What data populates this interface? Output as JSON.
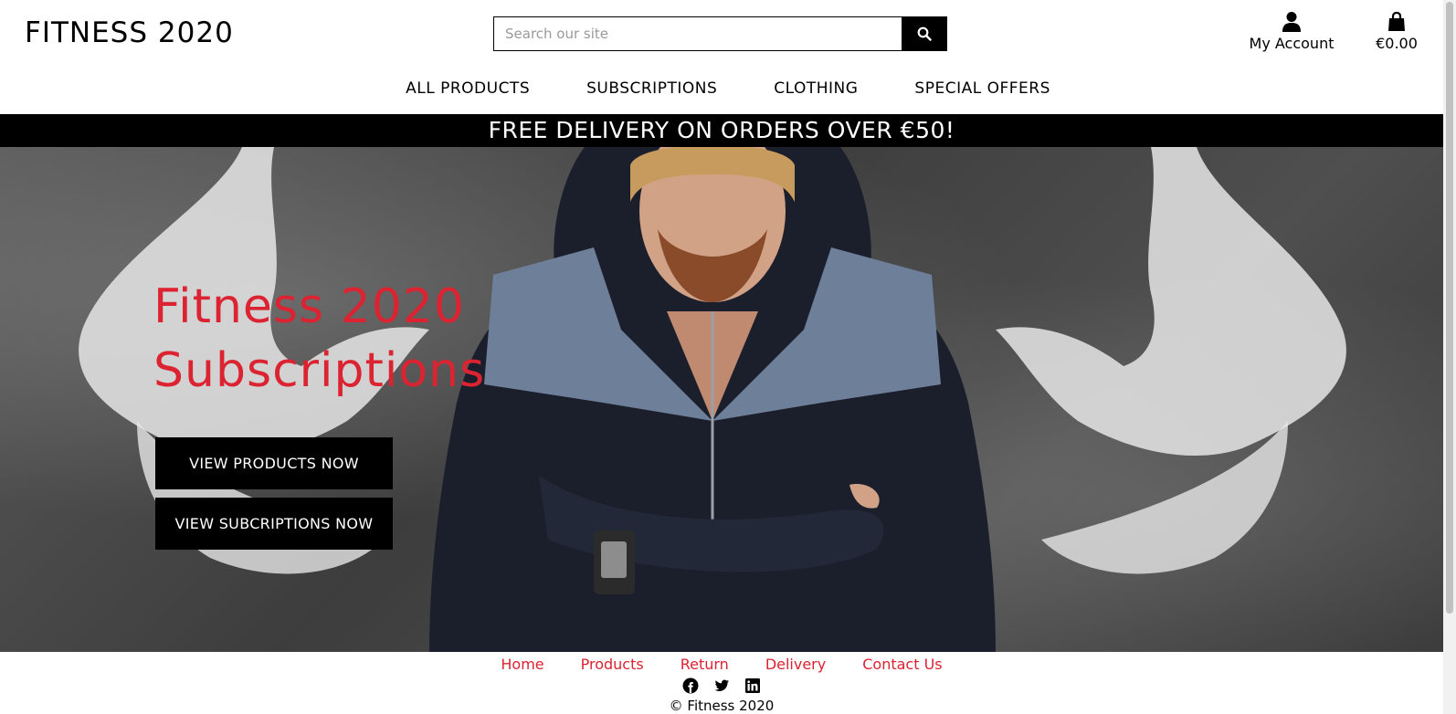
{
  "header": {
    "logo": "FITNESS 2020",
    "search": {
      "placeholder": "Search our site",
      "value": ""
    },
    "account_label": "My Account",
    "bag_total": "€0.00"
  },
  "nav": {
    "items": [
      {
        "label": "ALL PRODUCTS"
      },
      {
        "label": "SUBSCRIPTIONS"
      },
      {
        "label": "CLOTHING"
      },
      {
        "label": "SPECIAL OFFERS"
      }
    ]
  },
  "banner": {
    "text": "FREE DELIVERY ON ORDERS OVER €50!"
  },
  "hero": {
    "title_line1": "Fitness 2020",
    "title_line2": "Subscriptions",
    "buttons": {
      "products": "VIEW PRODUCTS NOW",
      "subscriptions": "VIEW SUBCRIPTIONS NOW"
    }
  },
  "footer": {
    "links": [
      {
        "label": "Home"
      },
      {
        "label": "Products"
      },
      {
        "label": "Return"
      },
      {
        "label": "Delivery"
      },
      {
        "label": "Contact Us"
      }
    ],
    "social": [
      "facebook-icon",
      "twitter-icon",
      "linkedin-icon"
    ],
    "copyright": "© Fitness 2020"
  },
  "colors": {
    "accent": "#dc2331",
    "dark": "#000000",
    "background": "#ffffff"
  }
}
